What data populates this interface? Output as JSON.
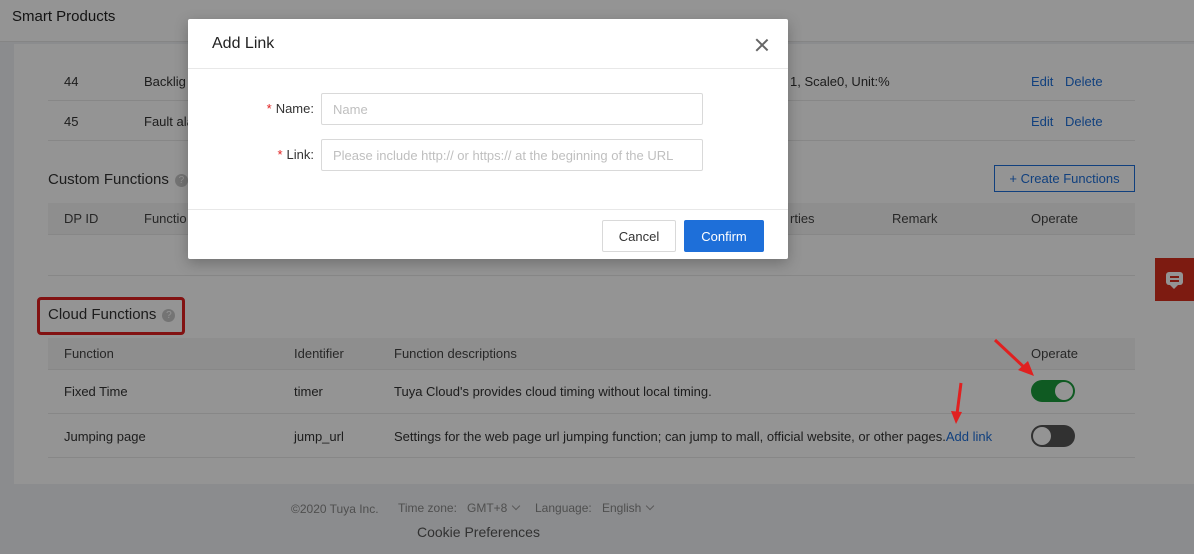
{
  "app": {
    "title": "Smart Products"
  },
  "standard_rows": [
    {
      "dp_id": "44",
      "name": "Backlig",
      "properties": "1, Scale0, Unit:%",
      "edit": "Edit",
      "delete": "Delete"
    },
    {
      "dp_id": "45",
      "name": "Fault ala",
      "properties": "",
      "edit": "Edit",
      "delete": "Delete"
    }
  ],
  "custom_functions": {
    "title": "Custom Functions",
    "help_icon": "help-icon",
    "create_button": "+ Create Functions",
    "columns": {
      "dp_id": "DP ID",
      "function": "Functio",
      "properties": "rties",
      "remark": "Remark",
      "operate": "Operate"
    }
  },
  "cloud_functions": {
    "title": "Cloud Functions",
    "help_icon": "help-icon",
    "columns": {
      "function": "Function",
      "identifier": "Identifier",
      "descriptions": "Function descriptions",
      "operate": "Operate"
    },
    "rows": [
      {
        "function": "Fixed Time",
        "identifier": "timer",
        "description": "Tuya Cloud's provides cloud timing without local timing.",
        "link": "",
        "enabled": true
      },
      {
        "function": "Jumping page",
        "identifier": "jump_url",
        "description": "Settings for the web page url jumping function; can jump to mall, official website, or other pages.",
        "link": "Add link",
        "enabled": false
      }
    ]
  },
  "footer": {
    "copyright": "©2020 Tuya Inc.",
    "timezone_label": "Time zone:",
    "timezone_value": "GMT+8",
    "language_label": "Language:",
    "language_value": "English",
    "cookie": "Cookie Preferences"
  },
  "chat_icon": "chat-icon",
  "modal": {
    "title": "Add Link",
    "close_icon": "close-icon",
    "name_label": "Name",
    "name_placeholder": "Name",
    "name_value": "",
    "link_label": "Link",
    "link_placeholder": "Please include http:// or https:// at the beginning of the URL",
    "link_value": "",
    "required_mark": "*",
    "label_suffix": ":",
    "cancel": "Cancel",
    "confirm": "Confirm"
  },
  "colors": {
    "accent": "#1e6fd9",
    "toggle_on": "#1a9b3c",
    "annotation_red": "#e02020"
  }
}
